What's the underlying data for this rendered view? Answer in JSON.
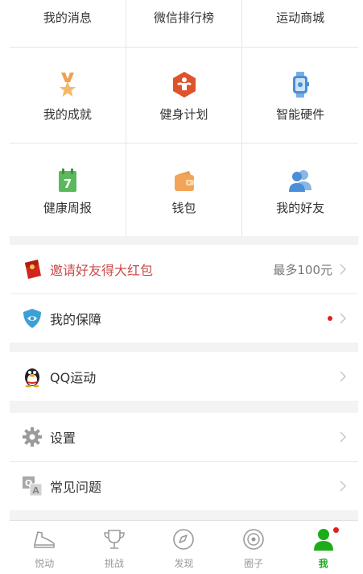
{
  "grid": {
    "row1": [
      "我的消息",
      "微信排行榜",
      "运动商城"
    ],
    "row2": [
      "我的成就",
      "健身计划",
      "智能硬件"
    ],
    "row3": [
      "健康周报",
      "钱包",
      "我的好友"
    ],
    "calendar_day": "7"
  },
  "list": {
    "invite": {
      "label": "邀请好友得大红包",
      "right": "最多100元"
    },
    "insurance": {
      "label": "我的保障"
    },
    "qq": {
      "label": "QQ运动"
    },
    "settings": {
      "label": "设置"
    },
    "faq": {
      "label": "常见问题"
    }
  },
  "tabs": [
    {
      "label": "悦动",
      "icon": "shoe-icon"
    },
    {
      "label": "挑战",
      "icon": "trophy-icon"
    },
    {
      "label": "发现",
      "icon": "compass-icon"
    },
    {
      "label": "圈子",
      "icon": "circle-icon"
    },
    {
      "label": "我",
      "icon": "person-icon",
      "active": true
    }
  ],
  "colors": {
    "accent_green": "#1aad19",
    "red_text": "#c94c4c",
    "badge_red": "#e02020"
  }
}
